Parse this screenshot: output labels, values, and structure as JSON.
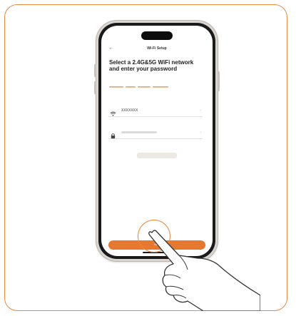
{
  "colors": {
    "accent": "#e7782f",
    "frame_border": "#e98a3c"
  },
  "screen": {
    "back_icon": "back-arrow-icon",
    "title": "Wi-Fi Setup",
    "heading": "Select a 2.4G&5G WiFi network and enter your password",
    "wifi_field": {
      "icon": "wifi-icon",
      "value": "XXXXXXX"
    },
    "password_field": {
      "icon": "lock-icon"
    },
    "next_button": {
      "label": "Next"
    }
  },
  "overlay": {
    "hand_icon": "pointing-hand-icon",
    "tap_indicator": "tap-ring"
  }
}
